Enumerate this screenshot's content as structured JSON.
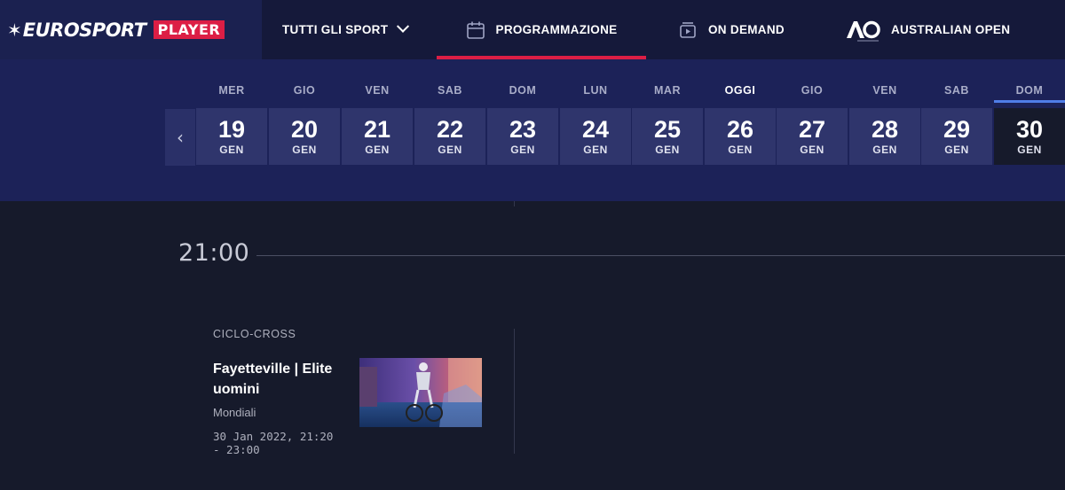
{
  "brand": {
    "name": "EUROSPORT",
    "badge": "PLAYER"
  },
  "nav": {
    "sports": "TUTTI GLI SPORT",
    "schedule": "PROGRAMMAZIONE",
    "on_demand": "ON DEMAND",
    "australian_open": "AUSTRALIAN OPEN"
  },
  "colors": {
    "accent": "#dc1e45",
    "selected": "#4f7ee8",
    "nav_bg": "#15193a",
    "datebar_bg": "#1c2258"
  },
  "days": [
    {
      "dow": "MER",
      "num": "19",
      "mon": "GEN"
    },
    {
      "dow": "GIO",
      "num": "20",
      "mon": "GEN"
    },
    {
      "dow": "VEN",
      "num": "21",
      "mon": "GEN"
    },
    {
      "dow": "SAB",
      "num": "22",
      "mon": "GEN"
    },
    {
      "dow": "DOM",
      "num": "23",
      "mon": "GEN"
    },
    {
      "dow": "LUN",
      "num": "24",
      "mon": "GEN"
    },
    {
      "dow": "MAR",
      "num": "25",
      "mon": "GEN"
    },
    {
      "dow": "OGGI",
      "num": "26",
      "mon": "GEN"
    },
    {
      "dow": "GIO",
      "num": "27",
      "mon": "GEN"
    },
    {
      "dow": "VEN",
      "num": "28",
      "mon": "GEN"
    },
    {
      "dow": "SAB",
      "num": "29",
      "mon": "GEN"
    },
    {
      "dow": "DOM",
      "num": "30",
      "mon": "GEN"
    }
  ],
  "schedule": {
    "time": "21:00",
    "event": {
      "sport": "CICLO-CROSS",
      "title": "Fayetteville | Elite uomini",
      "subtitle": "Mondiali",
      "datetime": "30 Jan 2022, 21:20 - 23:00"
    }
  }
}
